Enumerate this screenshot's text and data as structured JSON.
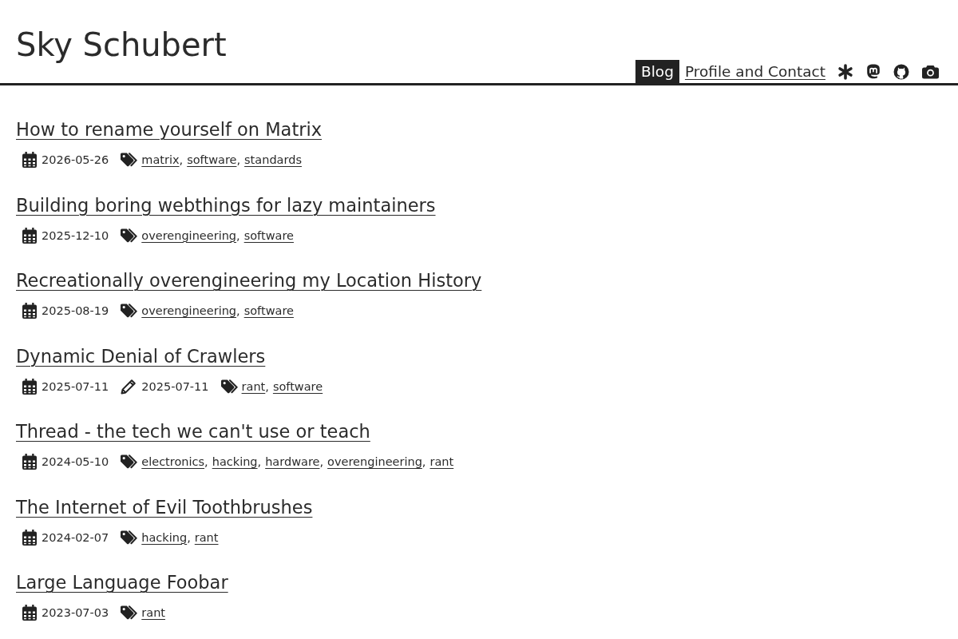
{
  "site": {
    "title": "Sky Schubert"
  },
  "nav": {
    "links": [
      {
        "label": "Blog",
        "selected": true
      },
      {
        "label": "Profile and Contact",
        "selected": false
      }
    ]
  },
  "posts": [
    {
      "title": "How to rename yourself on Matrix",
      "published": "2026-05-26",
      "tags": [
        {
          "label": "matrix",
          "suffix": ","
        },
        {
          "label": "software",
          "suffix": ","
        },
        {
          "label": "standards"
        }
      ]
    },
    {
      "title": "Building boring webthings for lazy maintainers",
      "published": "2025-12-10",
      "tags": [
        {
          "label": "overengineering",
          "suffix": ","
        },
        {
          "label": "software"
        }
      ]
    },
    {
      "title": "Recreationally overengineering my Location History",
      "published": "2025-08-19",
      "tags": [
        {
          "label": "overengineering",
          "suffix": ","
        },
        {
          "label": "software"
        }
      ]
    },
    {
      "title": "Dynamic Denial of Crawlers",
      "published": "2025-07-11",
      "updated": "2025-07-11",
      "tags": [
        {
          "label": "rant",
          "suffix": ","
        },
        {
          "label": "software"
        }
      ]
    },
    {
      "title": "Thread - the tech we can't use or teach",
      "published": "2024-05-10",
      "tags": [
        {
          "label": "electronics",
          "suffix": ","
        },
        {
          "label": "hacking",
          "suffix": ","
        },
        {
          "label": "hardware",
          "suffix": ","
        },
        {
          "label": "overengineering",
          "suffix": ","
        },
        {
          "label": "rant"
        }
      ]
    },
    {
      "title": "The Internet of Evil Toothbrushes",
      "published": "2024-02-07",
      "tags": [
        {
          "label": "hacking",
          "suffix": ","
        },
        {
          "label": "rant"
        }
      ]
    },
    {
      "title": "Large Language Foobar",
      "published": "2023-07-03",
      "tags": [
        {
          "label": "rant"
        }
      ]
    }
  ]
}
